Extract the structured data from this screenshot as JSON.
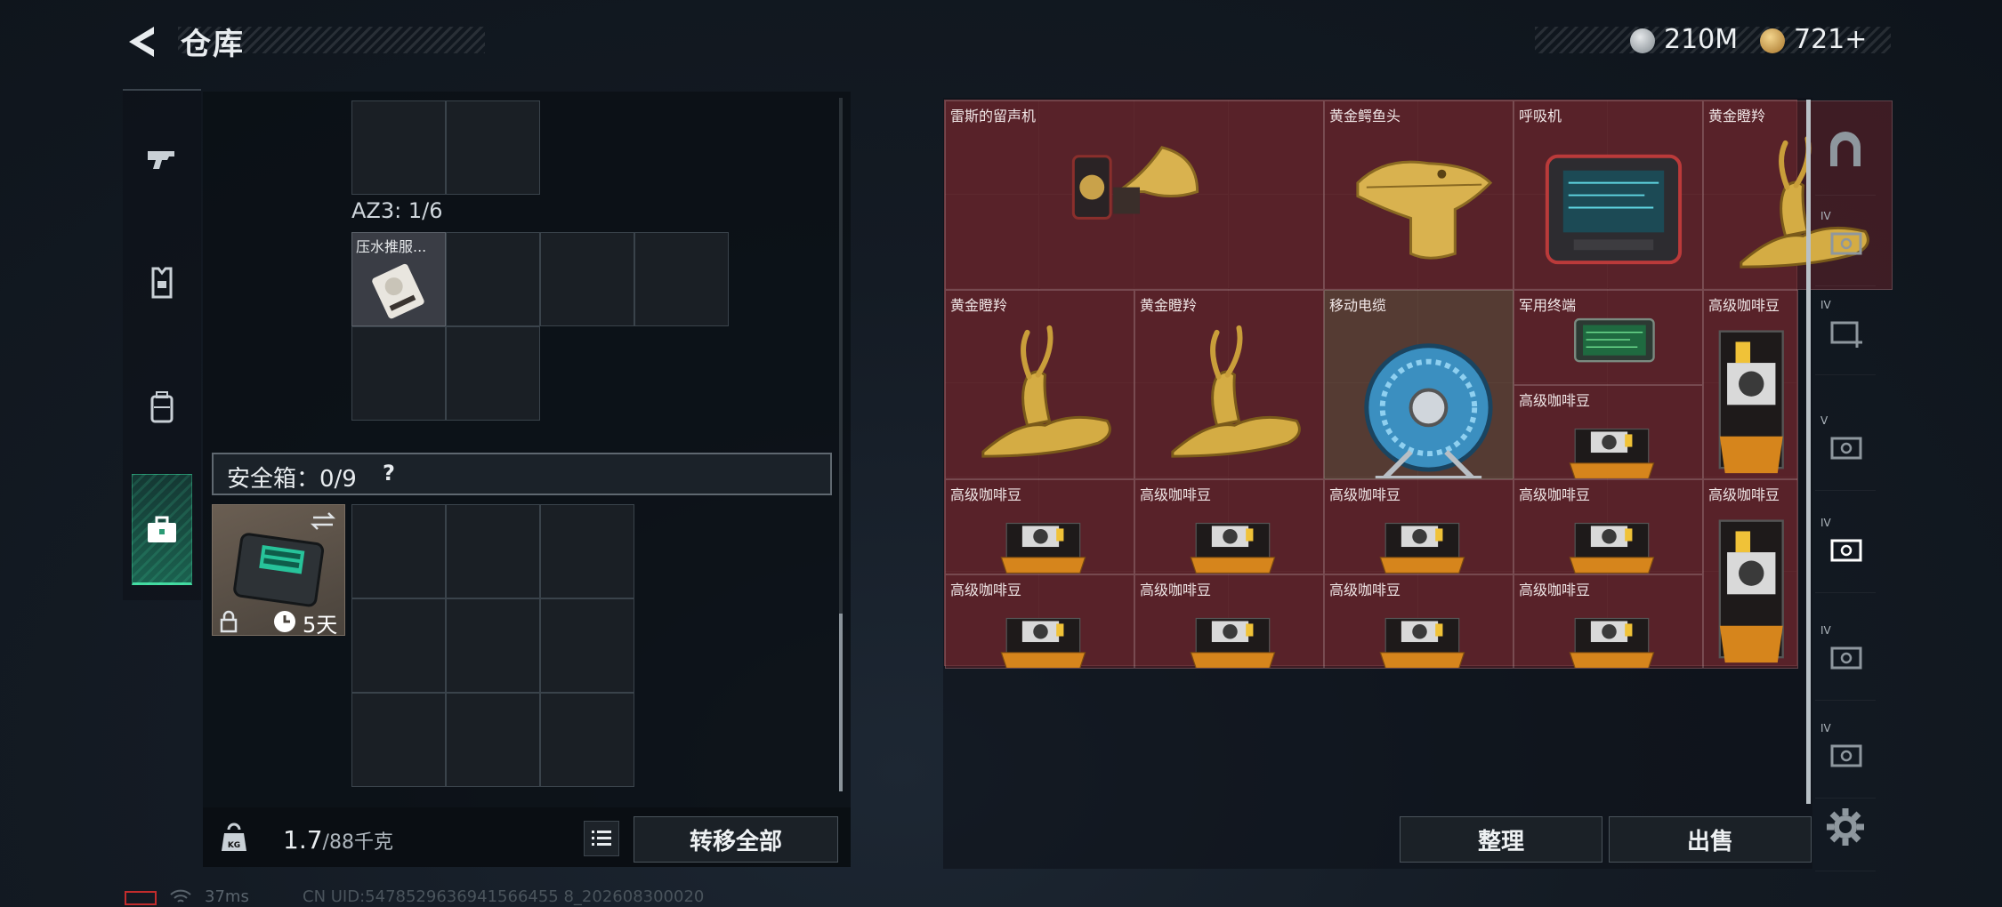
{
  "header": {
    "title": "仓库",
    "back_icon": "back-arrow-icon",
    "currency": [
      {
        "icon": "silver-coin-icon",
        "value": "210M"
      },
      {
        "icon": "gold-coin-icon",
        "value": "721+"
      }
    ]
  },
  "left_nav": [
    {
      "icon": "gun-icon",
      "name": "weapons"
    },
    {
      "icon": "armor-vest-icon",
      "name": "armor"
    },
    {
      "icon": "backpack-icon",
      "name": "backpack"
    },
    {
      "icon": "toolbox-icon",
      "name": "safe-box",
      "active": true
    }
  ],
  "loadout": {
    "az3_label": "AZ3: 1/6",
    "item_name": "压水推服...",
    "safebox_label": "安全箱：0/9",
    "help": "?",
    "safe_case_days": "5天",
    "weight": "1.7",
    "weight_unit": "/88千克",
    "transfer_all": "转移全部"
  },
  "stash_items": [
    {
      "name": "雷斯的留声机",
      "icon": "gramophone-icon"
    },
    {
      "name": "黄金鳄鱼头",
      "icon": "gold-crocodile-head-icon"
    },
    {
      "name": "呼吸机",
      "icon": "ventilator-icon"
    },
    {
      "name": "黄金瞪羚",
      "icon": "gold-gazelle-icon"
    },
    {
      "name": "黄金瞪羚",
      "icon": "gold-gazelle-icon"
    },
    {
      "name": "黄金瞪羚",
      "icon": "gold-gazelle-icon"
    },
    {
      "name": "移动电缆",
      "icon": "cable-reel-icon"
    },
    {
      "name": "军用终端",
      "icon": "military-terminal-icon"
    },
    {
      "name": "高级咖啡豆",
      "icon": "coffee-bag-icon"
    },
    {
      "name": "高级咖啡豆",
      "icon": "coffee-bag-icon"
    },
    {
      "name": "高级咖啡豆",
      "icon": "coffee-bag-icon"
    },
    {
      "name": "高级咖啡豆",
      "icon": "coffee-bag-icon"
    },
    {
      "name": "高级咖啡豆",
      "icon": "coffee-bag-icon"
    },
    {
      "name": "高级咖啡豆",
      "icon": "coffee-bag-icon"
    },
    {
      "name": "高级咖啡豆",
      "icon": "coffee-bag-icon"
    },
    {
      "name": "高级咖啡豆",
      "icon": "coffee-bag-icon"
    },
    {
      "name": "高级咖啡豆",
      "icon": "coffee-bag-icon"
    },
    {
      "name": "高级咖啡豆",
      "icon": "coffee-bag-icon"
    },
    {
      "name": "高级咖啡豆",
      "icon": "coffee-bag-icon"
    }
  ],
  "stash_buttons": {
    "sort": "整理",
    "sell": "出售"
  },
  "right_nav": [
    {
      "icon": "arch-tab-icon",
      "num": ""
    },
    {
      "icon": "stash-tab-icon",
      "num": "IV"
    },
    {
      "icon": "stash-add-tab-icon",
      "num": "IV"
    },
    {
      "icon": "stash-tab-icon",
      "num": "V"
    },
    {
      "icon": "stash-tab-icon",
      "num": "IV",
      "active": true
    },
    {
      "icon": "stash-tab-icon",
      "num": "IV"
    },
    {
      "icon": "stash-tab-icon",
      "num": "IV"
    },
    {
      "icon": "settings-gear-icon",
      "num": ""
    }
  ],
  "status": {
    "ping": "37ms",
    "uid": "CN UID:5478529636941566455 8_202608300020"
  },
  "colors": {
    "accent_green": "#43d9a0",
    "stash_bg": "#4a2328",
    "danger_red": "#c22c2c"
  }
}
